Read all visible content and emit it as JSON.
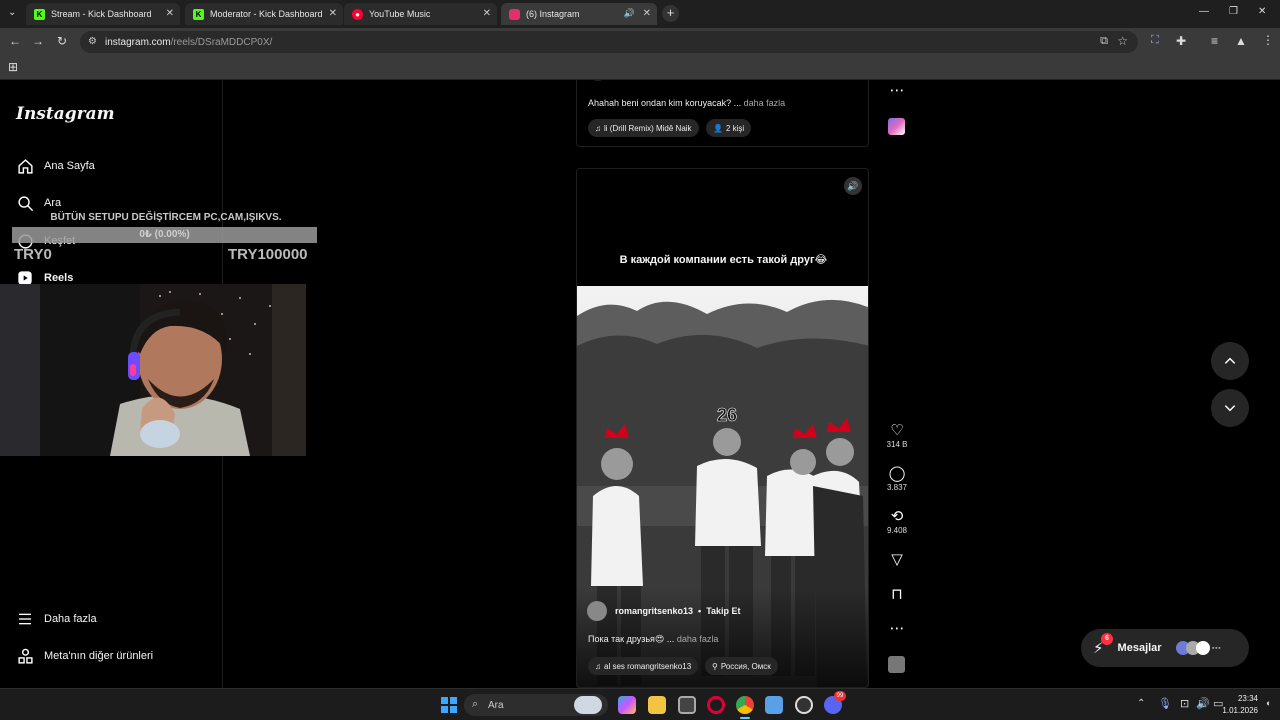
{
  "browser": {
    "tabs": [
      {
        "title": "Stream - Kick Dashboard",
        "icon": "kick-icon",
        "color": "#53fc18"
      },
      {
        "title": "Moderator - Kick Dashboard",
        "icon": "kick-icon",
        "color": "#53fc18"
      },
      {
        "title": "YouTube Music",
        "icon": "youtube-music-icon",
        "color": "#ff0033"
      },
      {
        "title": "(6) Instagram",
        "icon": "instagram-icon",
        "color": "#e1306c"
      }
    ],
    "url_host": "instagram.com",
    "url_path": "/reels/DSraMDDCP0X/"
  },
  "sidebar": {
    "logo": "Instagram",
    "items": [
      {
        "label": "Ana Sayfa",
        "icon": "home-icon"
      },
      {
        "label": "Ara",
        "icon": "search-icon"
      },
      {
        "label": "Keşfet",
        "icon": "compass-icon"
      },
      {
        "label": "Reels",
        "icon": "reels-icon"
      },
      {
        "label": "Daha fazla",
        "icon": "menu-icon"
      },
      {
        "label": "Meta'nın diğer ürünleri",
        "icon": "meta-apps-icon"
      }
    ]
  },
  "overlay": {
    "goal_text": "BÜTÜN SETUPU DEĞİŞTİRCEM PC,CAM,IŞIKVS.",
    "progress_text": "0₺ (0.00%)",
    "progress": 0,
    "min_label": "TRY0",
    "max_label": "TRY100000"
  },
  "reel_prev": {
    "caption": "Ahahah beni ondan kim koruyacak? ...",
    "more": "daha fazla",
    "audio": "li (Drill Remix)  Midê Naik",
    "people": "2 kişi"
  },
  "reel": {
    "top_text": "В каждой компании есть такой друг😂",
    "number": "26",
    "username": "romangritsenko13",
    "follow": "Takip Et",
    "caption": "Пока так друзья😍 ...",
    "more": "daha fazla",
    "audio": "al ses  romangritsenko13",
    "location": "Россия, Омск"
  },
  "actions": {
    "likes": "314 B",
    "comments": "3.837",
    "reposts": "9.408"
  },
  "messages": {
    "label": "Mesajlar",
    "badge": "6"
  },
  "taskbar": {
    "search": "Ara",
    "time": "23:34",
    "date": "1.01.2026",
    "badge": "99"
  }
}
